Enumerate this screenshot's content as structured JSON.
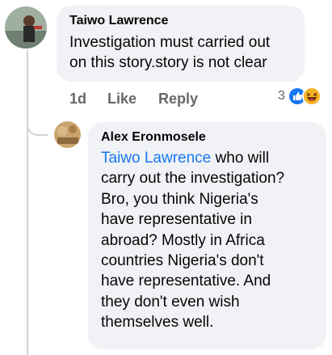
{
  "comment": {
    "author": "Taiwo Lawrence",
    "lines": [
      "Investigation must carried out",
      "on this story.story is not clear"
    ],
    "time": "1d",
    "like_label": "Like",
    "reply_label": "Reply",
    "reaction_count": "3",
    "reactions": [
      "like-icon",
      "haha-icon"
    ]
  },
  "reply": {
    "author": "Alex Eronmosele",
    "mention": "Taiwo Lawrence",
    "first_line_rest": " who will",
    "lines": [
      "carry out the investigation?",
      "Bro, you think Nigeria's",
      "have representative in",
      "abroad? Mostly in Africa",
      "countries Nigeria's don't",
      "have representative. And",
      "they don't even wish",
      "themselves well."
    ]
  },
  "colors": {
    "bubble": "#f0f2f5",
    "mention": "#1877f2",
    "meta": "#65676b",
    "like": "#1877f2",
    "haha": "#f7b125"
  }
}
